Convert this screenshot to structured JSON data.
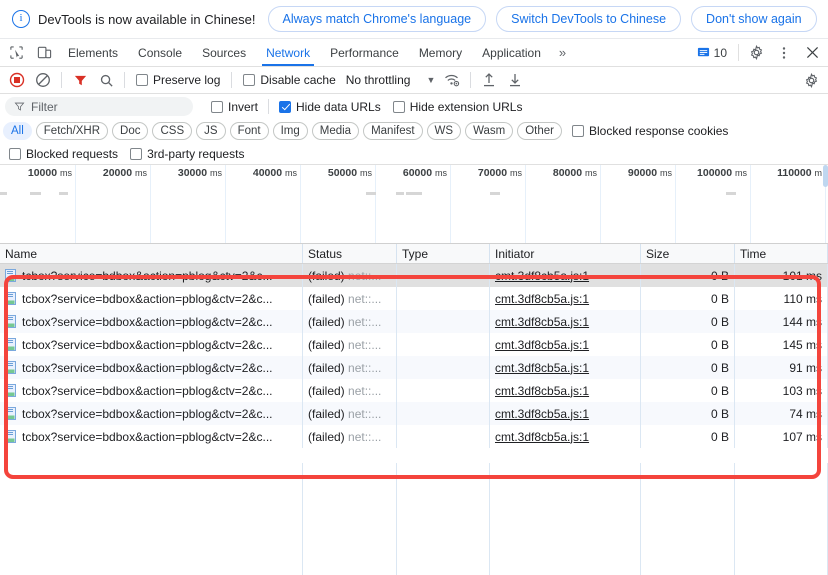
{
  "banner": {
    "icon": "info-icon",
    "message": "DevTools is now available in Chinese!",
    "buttons": [
      {
        "label": "Always match Chrome's language"
      },
      {
        "label": "Switch DevTools to Chinese"
      },
      {
        "label": "Don't show again"
      }
    ],
    "close_label": "✕"
  },
  "tabbar": {
    "left_icons": [
      {
        "name": "inspect-element-icon"
      },
      {
        "name": "device-toolbar-icon"
      }
    ],
    "tabs": [
      {
        "label": "Elements",
        "active": false
      },
      {
        "label": "Console",
        "active": false
      },
      {
        "label": "Sources",
        "active": false
      },
      {
        "label": "Network",
        "active": true
      },
      {
        "label": "Performance",
        "active": false
      },
      {
        "label": "Memory",
        "active": false
      },
      {
        "label": "Application",
        "active": false
      }
    ],
    "more_tabs_label": "»",
    "message_count": "10",
    "settings_label": "settings-icon",
    "more_label": "more-options-icon",
    "close_label": "✕"
  },
  "network_toolbar": {
    "record_icon": "record-stop-icon",
    "clear_icon": "clear-icon",
    "filter_icon": "filter-funnel-icon",
    "search_icon": "search-icon",
    "preserve_log": {
      "label": "Preserve log",
      "checked": false
    },
    "disable_cache": {
      "label": "Disable cache",
      "checked": false
    },
    "throttling": {
      "value": "No throttling",
      "caret": "▼"
    },
    "wifi_icon": "network-conditions-icon",
    "import_icon": "import-har-icon",
    "export_icon": "export-har-icon",
    "settings_icon": "network-settings-icon"
  },
  "filter_row": {
    "filter_placeholder": "Filter",
    "filter_value": "",
    "invert": {
      "label": "Invert",
      "checked": false
    },
    "hide_data_urls": {
      "label": "Hide data URLs",
      "checked": true
    },
    "hide_extension_urls": {
      "label": "Hide extension URLs",
      "checked": false
    }
  },
  "type_filters": [
    {
      "label": "All",
      "selected": true
    },
    {
      "label": "Fetch/XHR",
      "selected": false
    },
    {
      "label": "Doc",
      "selected": false
    },
    {
      "label": "CSS",
      "selected": false
    },
    {
      "label": "JS",
      "selected": false
    },
    {
      "label": "Font",
      "selected": false
    },
    {
      "label": "Img",
      "selected": false
    },
    {
      "label": "Media",
      "selected": false
    },
    {
      "label": "Manifest",
      "selected": false
    },
    {
      "label": "WS",
      "selected": false
    },
    {
      "label": "Wasm",
      "selected": false
    },
    {
      "label": "Other",
      "selected": false
    }
  ],
  "blocked_response_cookies": {
    "label": "Blocked response cookies",
    "checked": false
  },
  "extra_checkboxes": [
    {
      "label": "Blocked requests",
      "checked": false
    },
    {
      "label": "3rd-party requests",
      "checked": false
    }
  ],
  "overview": {
    "ticks": [
      {
        "value": "10000",
        "unit": "ms"
      },
      {
        "value": "20000",
        "unit": "ms"
      },
      {
        "value": "30000",
        "unit": "ms"
      },
      {
        "value": "40000",
        "unit": "ms"
      },
      {
        "value": "50000",
        "unit": "ms"
      },
      {
        "value": "60000",
        "unit": "ms"
      },
      {
        "value": "70000",
        "unit": "ms"
      },
      {
        "value": "80000",
        "unit": "ms"
      },
      {
        "value": "90000",
        "unit": "ms"
      },
      {
        "value": "100000",
        "unit": "ms"
      },
      {
        "value": "110000",
        "unit": "m"
      }
    ]
  },
  "table": {
    "columns": [
      "Name",
      "Status",
      "Type",
      "Initiator",
      "Size",
      "Time"
    ],
    "rows": [
      {
        "name": "tcbox?service=bdbox&action=pblog&ctv=2&c...",
        "status_main": "(failed)",
        "status_sub": "net::...",
        "type": "",
        "initiator": "cmt.3df8cb5a.js:1",
        "size": "0 B",
        "time": "101 ms",
        "selected": true
      },
      {
        "name": "tcbox?service=bdbox&action=pblog&ctv=2&c...",
        "status_main": "(failed)",
        "status_sub": "net::...",
        "type": "",
        "initiator": "cmt.3df8cb5a.js:1",
        "size": "0 B",
        "time": "110 ms",
        "selected": false
      },
      {
        "name": "tcbox?service=bdbox&action=pblog&ctv=2&c...",
        "status_main": "(failed)",
        "status_sub": "net::...",
        "type": "",
        "initiator": "cmt.3df8cb5a.js:1",
        "size": "0 B",
        "time": "144 ms",
        "selected": false
      },
      {
        "name": "tcbox?service=bdbox&action=pblog&ctv=2&c...",
        "status_main": "(failed)",
        "status_sub": "net::...",
        "type": "",
        "initiator": "cmt.3df8cb5a.js:1",
        "size": "0 B",
        "time": "145 ms",
        "selected": false
      },
      {
        "name": "tcbox?service=bdbox&action=pblog&ctv=2&c...",
        "status_main": "(failed)",
        "status_sub": "net::...",
        "type": "",
        "initiator": "cmt.3df8cb5a.js:1",
        "size": "0 B",
        "time": "91 ms",
        "selected": false
      },
      {
        "name": "tcbox?service=bdbox&action=pblog&ctv=2&c...",
        "status_main": "(failed)",
        "status_sub": "net::...",
        "type": "",
        "initiator": "cmt.3df8cb5a.js:1",
        "size": "0 B",
        "time": "103 ms",
        "selected": false
      },
      {
        "name": "tcbox?service=bdbox&action=pblog&ctv=2&c...",
        "status_main": "(failed)",
        "status_sub": "net::...",
        "type": "",
        "initiator": "cmt.3df8cb5a.js:1",
        "size": "0 B",
        "time": "74 ms",
        "selected": false
      },
      {
        "name": "tcbox?service=bdbox&action=pblog&ctv=2&c...",
        "status_main": "(failed)",
        "status_sub": "net::...",
        "type": "",
        "initiator": "cmt.3df8cb5a.js:1",
        "size": "0 B",
        "time": "107 ms",
        "selected": false
      }
    ]
  },
  "annotation": {
    "color": "#f4443c"
  }
}
